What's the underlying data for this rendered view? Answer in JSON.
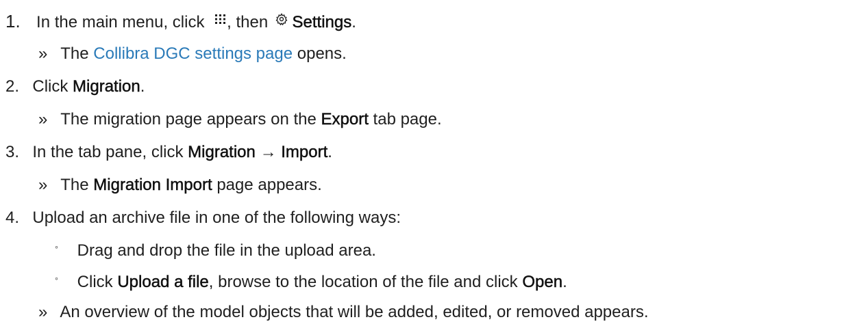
{
  "steps": [
    {
      "number": "1.",
      "parts": {
        "a": "In the main menu, click",
        "b": ", then",
        "c": "Settings",
        "d": "."
      },
      "icons": [
        "grid-menu-icon",
        "settings-gear-icon"
      ],
      "result": {
        "marker": "»",
        "a": "The",
        "link": "Collibra DGC settings page",
        "b": "opens."
      }
    },
    {
      "number": "2.",
      "parts": {
        "a": "Click",
        "b": "Migration",
        "c": "."
      },
      "result": {
        "marker": "»",
        "a": "The migration page appears on the",
        "b": "Export",
        "c": "tab page."
      }
    },
    {
      "number": "3.",
      "parts": {
        "a": "In the tab pane, click",
        "b": "Migration",
        "c": "→",
        "d": "Import",
        "e": "."
      },
      "result": {
        "marker": "»",
        "a": "The",
        "b": "Migration Import",
        "c": "page appears."
      }
    },
    {
      "number": "4.",
      "parts": {
        "a": "Upload an archive file in one of the following ways:"
      },
      "sub_items": [
        {
          "marker": "◦",
          "a": "Drag and drop the file in the upload area."
        },
        {
          "marker": "◦",
          "a": "Click",
          "b": "Upload a file",
          "c": ", browse to the location of the file and click",
          "d": "Open",
          "e": "."
        }
      ],
      "result": {
        "marker": "»",
        "a": "An overview of the model objects that will be added, edited, or removed appears."
      }
    }
  ]
}
